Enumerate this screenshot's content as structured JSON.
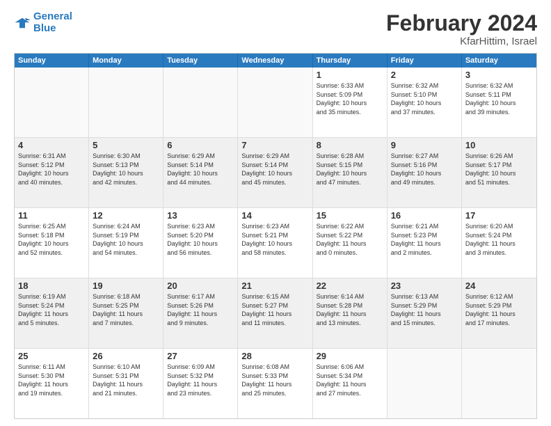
{
  "logo": {
    "line1": "General",
    "line2": "Blue"
  },
  "title": "February 2024",
  "subtitle": "KfarHittim, Israel",
  "days_of_week": [
    "Sunday",
    "Monday",
    "Tuesday",
    "Wednesday",
    "Thursday",
    "Friday",
    "Saturday"
  ],
  "weeks": [
    [
      {
        "day": "",
        "info": "",
        "empty": true
      },
      {
        "day": "",
        "info": "",
        "empty": true
      },
      {
        "day": "",
        "info": "",
        "empty": true
      },
      {
        "day": "",
        "info": "",
        "empty": true
      },
      {
        "day": "1",
        "info": "Sunrise: 6:33 AM\nSunset: 5:09 PM\nDaylight: 10 hours\nand 35 minutes."
      },
      {
        "day": "2",
        "info": "Sunrise: 6:32 AM\nSunset: 5:10 PM\nDaylight: 10 hours\nand 37 minutes."
      },
      {
        "day": "3",
        "info": "Sunrise: 6:32 AM\nSunset: 5:11 PM\nDaylight: 10 hours\nand 39 minutes."
      }
    ],
    [
      {
        "day": "4",
        "info": "Sunrise: 6:31 AM\nSunset: 5:12 PM\nDaylight: 10 hours\nand 40 minutes.",
        "shaded": true
      },
      {
        "day": "5",
        "info": "Sunrise: 6:30 AM\nSunset: 5:13 PM\nDaylight: 10 hours\nand 42 minutes.",
        "shaded": true
      },
      {
        "day": "6",
        "info": "Sunrise: 6:29 AM\nSunset: 5:14 PM\nDaylight: 10 hours\nand 44 minutes.",
        "shaded": true
      },
      {
        "day": "7",
        "info": "Sunrise: 6:29 AM\nSunset: 5:14 PM\nDaylight: 10 hours\nand 45 minutes.",
        "shaded": true
      },
      {
        "day": "8",
        "info": "Sunrise: 6:28 AM\nSunset: 5:15 PM\nDaylight: 10 hours\nand 47 minutes.",
        "shaded": true
      },
      {
        "day": "9",
        "info": "Sunrise: 6:27 AM\nSunset: 5:16 PM\nDaylight: 10 hours\nand 49 minutes.",
        "shaded": true
      },
      {
        "day": "10",
        "info": "Sunrise: 6:26 AM\nSunset: 5:17 PM\nDaylight: 10 hours\nand 51 minutes.",
        "shaded": true
      }
    ],
    [
      {
        "day": "11",
        "info": "Sunrise: 6:25 AM\nSunset: 5:18 PM\nDaylight: 10 hours\nand 52 minutes."
      },
      {
        "day": "12",
        "info": "Sunrise: 6:24 AM\nSunset: 5:19 PM\nDaylight: 10 hours\nand 54 minutes."
      },
      {
        "day": "13",
        "info": "Sunrise: 6:23 AM\nSunset: 5:20 PM\nDaylight: 10 hours\nand 56 minutes."
      },
      {
        "day": "14",
        "info": "Sunrise: 6:23 AM\nSunset: 5:21 PM\nDaylight: 10 hours\nand 58 minutes."
      },
      {
        "day": "15",
        "info": "Sunrise: 6:22 AM\nSunset: 5:22 PM\nDaylight: 11 hours\nand 0 minutes."
      },
      {
        "day": "16",
        "info": "Sunrise: 6:21 AM\nSunset: 5:23 PM\nDaylight: 11 hours\nand 2 minutes."
      },
      {
        "day": "17",
        "info": "Sunrise: 6:20 AM\nSunset: 5:24 PM\nDaylight: 11 hours\nand 3 minutes."
      }
    ],
    [
      {
        "day": "18",
        "info": "Sunrise: 6:19 AM\nSunset: 5:24 PM\nDaylight: 11 hours\nand 5 minutes.",
        "shaded": true
      },
      {
        "day": "19",
        "info": "Sunrise: 6:18 AM\nSunset: 5:25 PM\nDaylight: 11 hours\nand 7 minutes.",
        "shaded": true
      },
      {
        "day": "20",
        "info": "Sunrise: 6:17 AM\nSunset: 5:26 PM\nDaylight: 11 hours\nand 9 minutes.",
        "shaded": true
      },
      {
        "day": "21",
        "info": "Sunrise: 6:15 AM\nSunset: 5:27 PM\nDaylight: 11 hours\nand 11 minutes.",
        "shaded": true
      },
      {
        "day": "22",
        "info": "Sunrise: 6:14 AM\nSunset: 5:28 PM\nDaylight: 11 hours\nand 13 minutes.",
        "shaded": true
      },
      {
        "day": "23",
        "info": "Sunrise: 6:13 AM\nSunset: 5:29 PM\nDaylight: 11 hours\nand 15 minutes.",
        "shaded": true
      },
      {
        "day": "24",
        "info": "Sunrise: 6:12 AM\nSunset: 5:29 PM\nDaylight: 11 hours\nand 17 minutes.",
        "shaded": true
      }
    ],
    [
      {
        "day": "25",
        "info": "Sunrise: 6:11 AM\nSunset: 5:30 PM\nDaylight: 11 hours\nand 19 minutes."
      },
      {
        "day": "26",
        "info": "Sunrise: 6:10 AM\nSunset: 5:31 PM\nDaylight: 11 hours\nand 21 minutes."
      },
      {
        "day": "27",
        "info": "Sunrise: 6:09 AM\nSunset: 5:32 PM\nDaylight: 11 hours\nand 23 minutes."
      },
      {
        "day": "28",
        "info": "Sunrise: 6:08 AM\nSunset: 5:33 PM\nDaylight: 11 hours\nand 25 minutes."
      },
      {
        "day": "29",
        "info": "Sunrise: 6:06 AM\nSunset: 5:34 PM\nDaylight: 11 hours\nand 27 minutes."
      },
      {
        "day": "",
        "info": "",
        "empty": true
      },
      {
        "day": "",
        "info": "",
        "empty": true
      }
    ]
  ]
}
